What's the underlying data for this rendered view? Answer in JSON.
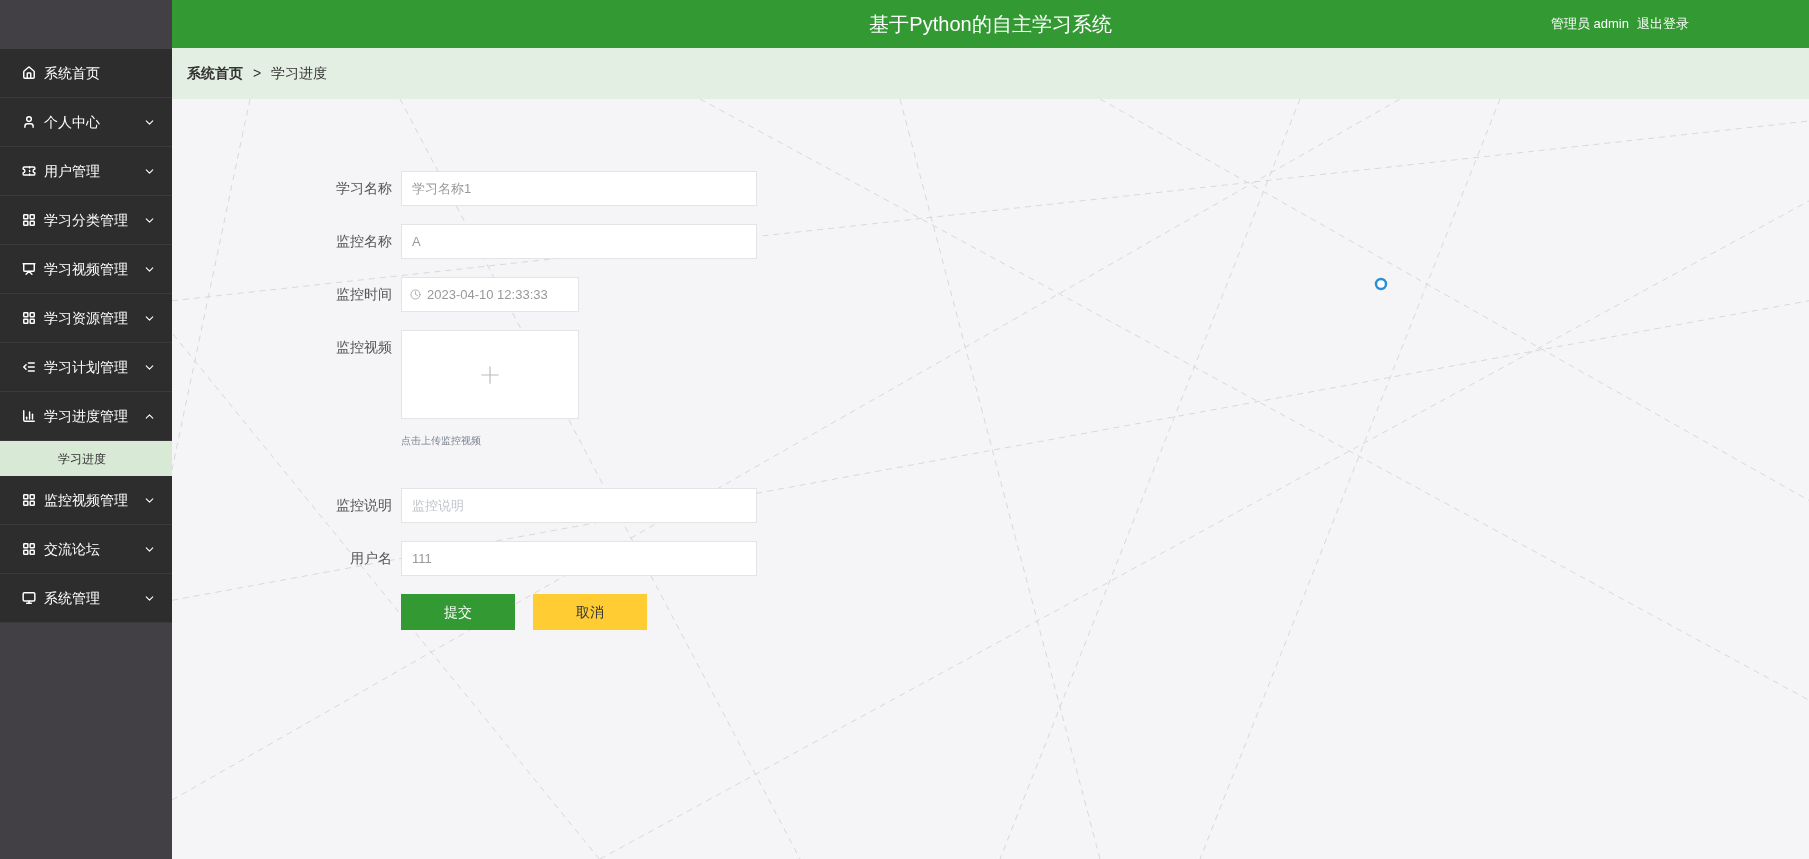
{
  "header": {
    "title": "基于Python的自主学习系统",
    "user": "管理员 admin",
    "logout": "退出登录"
  },
  "sidebar": {
    "items": [
      {
        "label": "系统首页",
        "kind": "link"
      },
      {
        "label": "个人中心",
        "kind": "menu",
        "expanded": false
      },
      {
        "label": "用户管理",
        "kind": "menu",
        "expanded": false
      },
      {
        "label": "学习分类管理",
        "kind": "menu",
        "expanded": false
      },
      {
        "label": "学习视频管理",
        "kind": "menu",
        "expanded": false
      },
      {
        "label": "学习资源管理",
        "kind": "menu",
        "expanded": false
      },
      {
        "label": "学习计划管理",
        "kind": "menu",
        "expanded": false
      },
      {
        "label": "学习进度管理",
        "kind": "menu",
        "expanded": true,
        "children": [
          {
            "label": "学习进度",
            "selected": true
          }
        ]
      },
      {
        "label": "监控视频管理",
        "kind": "menu",
        "expanded": false
      },
      {
        "label": "交流论坛",
        "kind": "menu",
        "expanded": false
      },
      {
        "label": "系统管理",
        "kind": "menu",
        "expanded": false
      }
    ]
  },
  "breadcrumb": {
    "items": [
      "系统首页",
      "学习进度"
    ],
    "separator": ">"
  },
  "form": {
    "fields": [
      {
        "label": "学习名称",
        "kind": "text",
        "value": "学习名称1"
      },
      {
        "label": "监控名称",
        "kind": "text",
        "value": "A"
      },
      {
        "label": "监控时间",
        "kind": "date",
        "value": "2023-04-10 12:33:33"
      },
      {
        "label": "监控视频",
        "kind": "upload",
        "hint": "点击上传监控视频"
      },
      {
        "label": "监控说明",
        "kind": "text",
        "placeholder": "监控说明"
      },
      {
        "label": "用户名",
        "kind": "text",
        "value": "111"
      }
    ],
    "buttons": [
      {
        "label": "提交",
        "kind": "primary"
      },
      {
        "label": "取消",
        "kind": "secondary"
      }
    ]
  }
}
